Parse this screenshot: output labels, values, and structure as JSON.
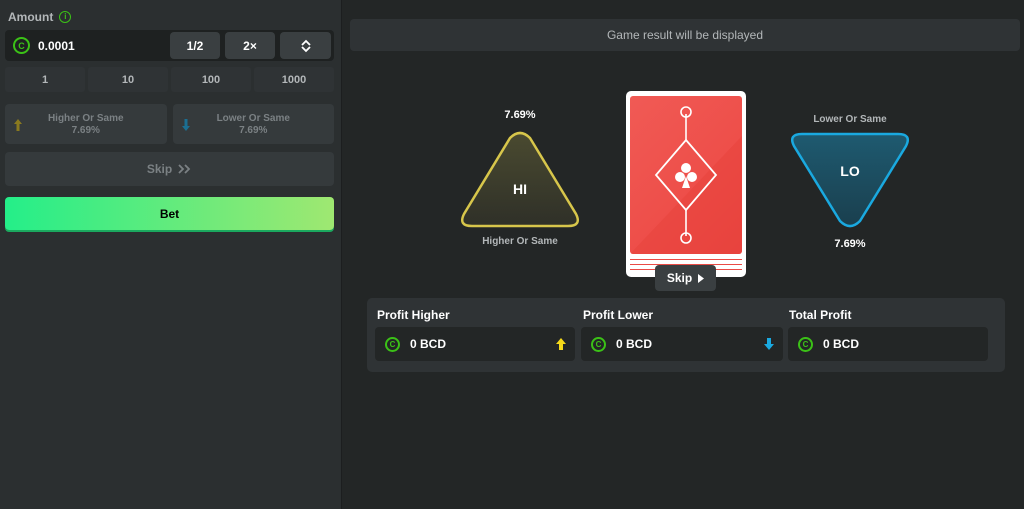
{
  "amount": {
    "label": "Amount",
    "value": "0.0001",
    "half_label": "1/2",
    "double_label": "2×"
  },
  "quick_amounts": [
    "1",
    "10",
    "100",
    "1000"
  ],
  "choices": {
    "higher": {
      "label": "Higher Or Same",
      "pct": "7.69%"
    },
    "lower": {
      "label": "Lower Or Same",
      "pct": "7.69%"
    }
  },
  "skip_label": "Skip",
  "bet_label": "Bet",
  "game": {
    "result_text": "Game result will be displayed",
    "hi": {
      "text": "HI",
      "pct": "7.69%",
      "label": "Higher Or Same"
    },
    "lo": {
      "text": "LO",
      "pct": "7.69%",
      "label": "Lower Or Same"
    },
    "card_skip_label": "Skip"
  },
  "profits": [
    {
      "title": "Profit Higher",
      "value": "0 BCD",
      "arrow": "up"
    },
    {
      "title": "Profit Lower",
      "value": "0 BCD",
      "arrow": "down"
    },
    {
      "title": "Total Profit",
      "value": "0 BCD",
      "arrow": ""
    }
  ],
  "colors": {
    "accent_green": "#3bc117",
    "bet_gradient_start": "#24ee89",
    "bet_gradient_end": "#9fe871",
    "hi_yellow": "#d7c64b",
    "lo_blue": "#1aa9e0",
    "card_red": "#ee4f4a",
    "arrow_up": "#f5d91a",
    "arrow_down": "#1aa9e0"
  }
}
